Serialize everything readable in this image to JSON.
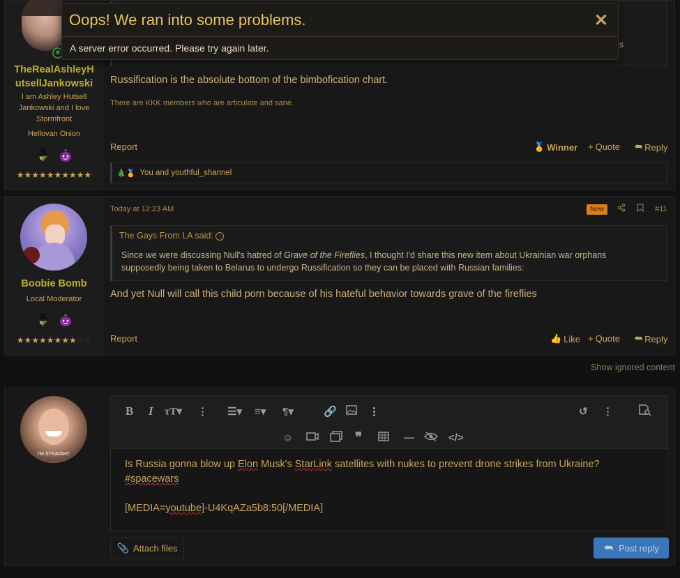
{
  "posts": [
    {
      "username": "TheRealAshleyHutsellJankowski",
      "username_line1": "TheRealAshleyH",
      "username_line2": "utsellJankowski",
      "user_title_lines": [
        "I am Ashley Hutsell",
        "Jankowski and I love",
        "Stormfront"
      ],
      "user_banner": "Hellovan Onion",
      "stars_on": "★★★★★★★★★★",
      "stars_off": "",
      "quote_tail": "s",
      "message": "Russification is the absolute bottom of the bimbofication chart.",
      "signature": "There are KKK members who are articulate and sane.",
      "actions": {
        "report": "Report",
        "winner": "Winner",
        "quote": "Quote",
        "reply": "Reply"
      },
      "reactions_text": "You and youthful_shannel"
    },
    {
      "username": "Boobie Bomb",
      "user_title": "Local Moderator",
      "stars_on": "★★★★★★★★",
      "stars_off": "☆☆",
      "date": "Today at 12:23 AM",
      "badge": "New",
      "post_number": "#11",
      "quote_author": "The Gays From LA said:",
      "quote_before": "Since we were discussing Null's hatred of ",
      "quote_italic": "Grave of the Fireflies",
      "quote_after": ", I thought I'd share this new item about Ukrainian war orphans supposedly being taken to Belarus to undergo Russification so they can be placed with Russian families:",
      "message": "And yet Null will call this child porn because of his hateful behavior towards grave of the fireflies",
      "actions": {
        "report": "Report",
        "like": "Like",
        "quote": "Quote",
        "reply": "Reply"
      }
    }
  ],
  "show_ignored": "Show ignored content",
  "editor": {
    "avatar_caption": "I'M STRAIGHT",
    "line1_before": "Is Russia gonna blow up ",
    "line1_elon": "Elon",
    "line1_mid": " Musk's ",
    "line1_starlink": "StarLink",
    "line1_after": " satellites with nukes to prevent drone strikes from Ukraine?",
    "line2": "#spacewars",
    "line3_before": "[MEDIA=",
    "line3_youtube": "youtube",
    "line3_after": "]-U4KqAZa5b8:50[/MEDIA]",
    "attach_label": "Attach files",
    "post_reply_label": "Post reply"
  },
  "toast": {
    "title": "Oops! We ran into some problems.",
    "message": "A server error occurred. Please try again later.",
    "close": "✕"
  },
  "colors": {
    "accent": "#c9a55c",
    "username": "#bfae2a",
    "badge_new": "#d8801c",
    "post_reply": "#3a76b8",
    "toast_title": "#e7c45c"
  }
}
